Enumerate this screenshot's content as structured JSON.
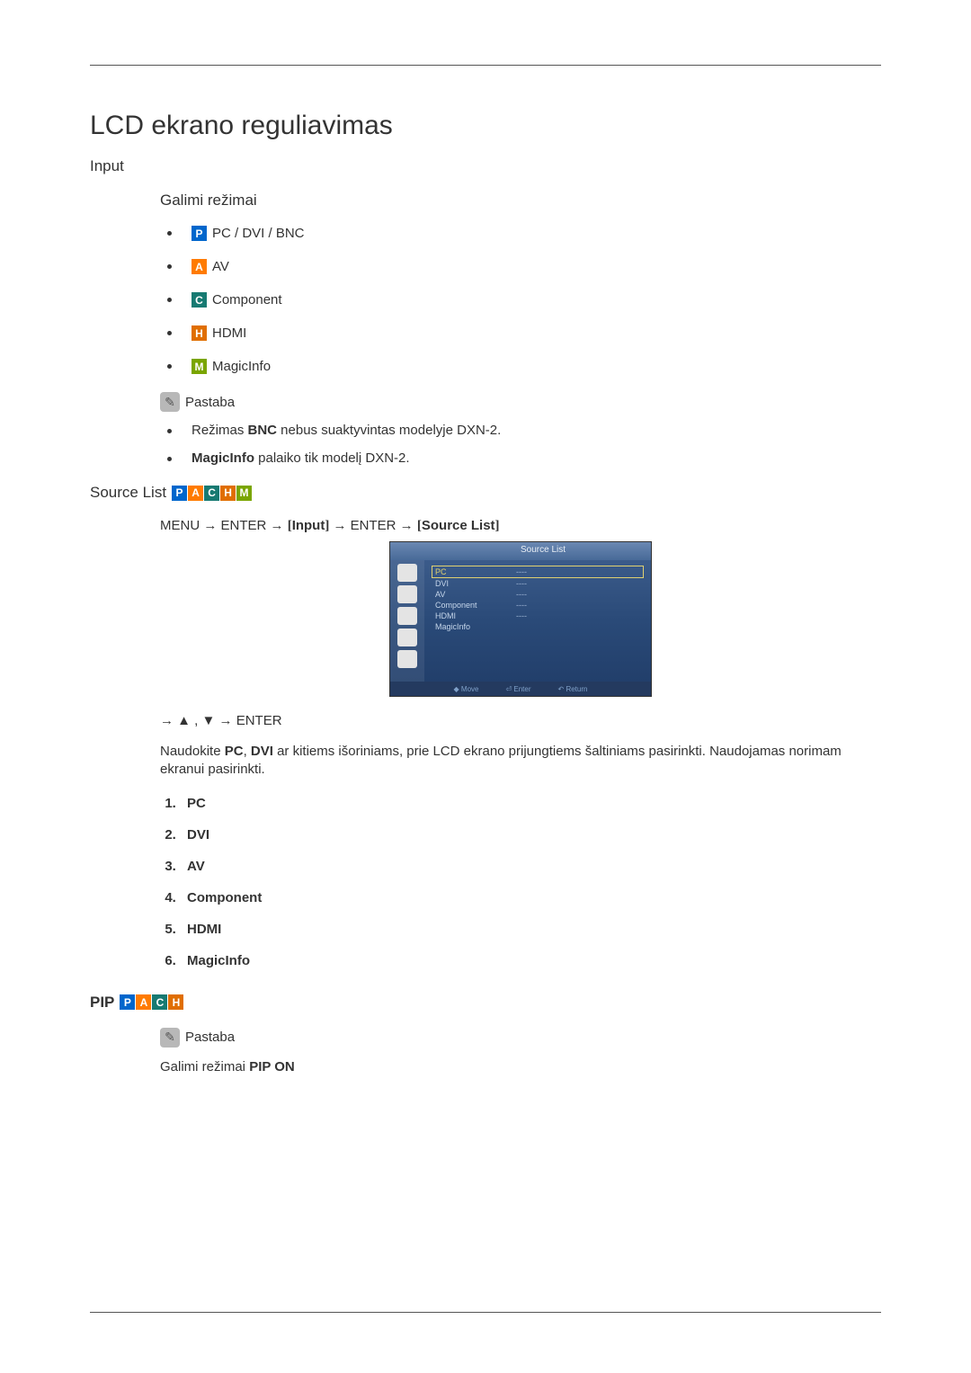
{
  "page_title": "LCD ekrano reguliavimas",
  "input": {
    "heading": "Input",
    "modes_heading": "Galimi režimai",
    "modes": {
      "pc": "PC / DVI / BNC",
      "av": "AV",
      "component": "Component",
      "hdmi": "HDMI",
      "magicinfo": "MagicInfo"
    },
    "note_label": "Pastaba",
    "notes": {
      "n1_pre": "Režimas ",
      "n1_bold": "BNC",
      "n1_post": " nebus suaktyvintas modelyje DXN-2.",
      "n2_bold": "MagicInfo",
      "n2_post": " palaiko tik modelį DXN-2."
    }
  },
  "source_list": {
    "heading": "Source List",
    "path_p1": "MENU → ENTER → ",
    "path_br1_open": "[",
    "path_br1_label": "Input",
    "path_br1_close": "]",
    "path_p2": " → ENTER → ",
    "path_br2_open": "[",
    "path_br2_label": "Source List",
    "path_br2_close": "]",
    "osd": {
      "title": "Source List",
      "rows": {
        "pc": "PC",
        "dvi": "DVI",
        "av": "AV",
        "component": "Component",
        "hdmi": "HDMI",
        "magicinfo": "MagicInfo"
      },
      "val_placeholder": "----",
      "footer_move": "◆ Move",
      "footer_enter": "⏎ Enter",
      "footer_return": "↶ Return"
    },
    "nav_line": "→ ▲ , ▼ → ENTER",
    "desc_pre": "Naudokite ",
    "desc_b1": "PC",
    "desc_mid1": ", ",
    "desc_b2": "DVI",
    "desc_post": " ar kitiems išoriniams, prie LCD ekrano prijungtiems šaltiniams pasirinkti. Naudojamas norimam ekranui pasirinkti.",
    "items": {
      "i1": "PC",
      "i2": "DVI",
      "i3": "AV",
      "i4": "Component",
      "i5": "HDMI",
      "i6": "MagicInfo"
    }
  },
  "pip": {
    "heading": "PIP",
    "note_label": "Pastaba",
    "note_pre": "Galimi režimai ",
    "note_bold": "PIP ON"
  },
  "icon_letters": {
    "p": "P",
    "a": "A",
    "c": "C",
    "h": "H",
    "m": "M"
  }
}
